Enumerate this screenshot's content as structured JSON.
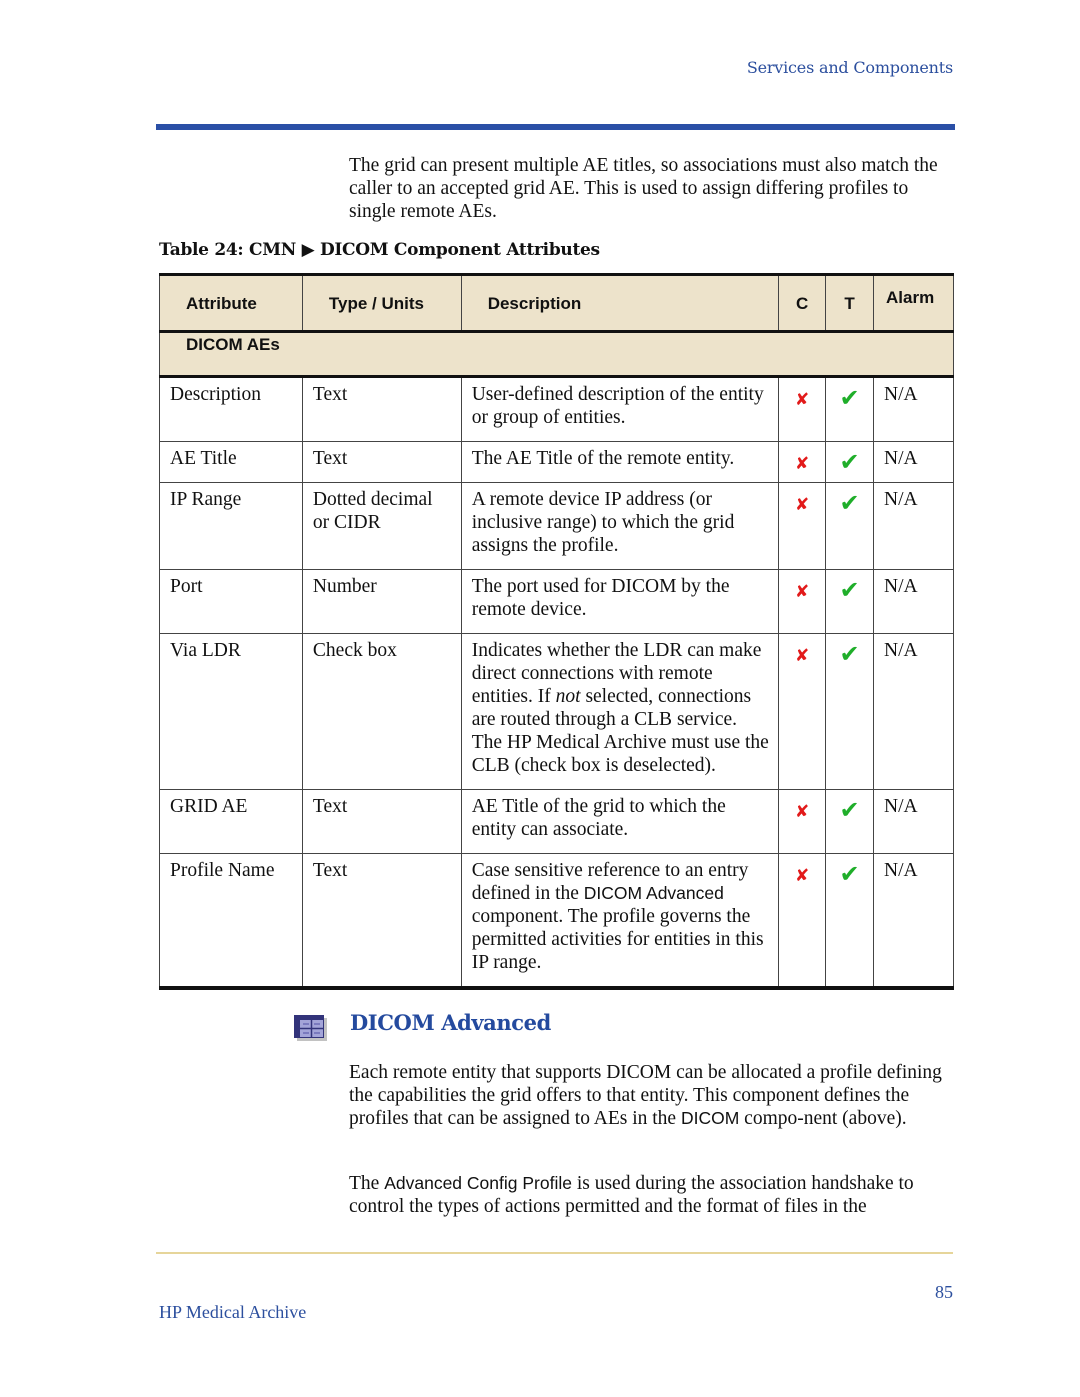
{
  "header": {
    "running_head": "Services and Components"
  },
  "intro_paragraph": "The grid can present multiple AE titles, so associations must also match the caller to an accepted grid AE. This is used to assign differing profiles to single remote AEs.",
  "table": {
    "caption": "Table 24: CMN ▶ DICOM Component Attributes",
    "columns": [
      "Attribute",
      "Type / Units",
      "Description",
      "C",
      "T",
      "Alarm"
    ],
    "group_label": "DICOM AEs",
    "rows": [
      {
        "attribute": "Description",
        "type": "Text",
        "description": "User-defined description of the entity or group of entities.",
        "c": "✘",
        "t": "✔",
        "alarm": "N/A"
      },
      {
        "attribute": "AE Title",
        "type": "Text",
        "description": "The AE Title of the remote entity.",
        "c": "✘",
        "t": "✔",
        "alarm": "N/A"
      },
      {
        "attribute": "IP Range",
        "type": "Dotted decimal or CIDR",
        "description": "A remote device IP address (or inclusive range) to which the grid assigns the profile.",
        "c": "✘",
        "t": "✔",
        "alarm": "N/A"
      },
      {
        "attribute": "Port",
        "type": "Number",
        "description": "The port used for DICOM by the remote device.",
        "c": "✘",
        "t": "✔",
        "alarm": "N/A"
      },
      {
        "attribute": "Via LDR",
        "type": "Check box",
        "description_parts": [
          "Indicates whether the LDR can make direct connections with remote entities. If ",
          "not",
          " selected, connections are routed through a CLB service. The HP Medical Archive must use the CLB (check box is deselected)."
        ],
        "c": "✘",
        "t": "✔",
        "alarm": "N/A"
      },
      {
        "attribute": "GRID AE",
        "type": "Text",
        "description": "AE Title of the grid to which the entity can associate.",
        "c": "✘",
        "t": "✔",
        "alarm": "N/A"
      },
      {
        "attribute": "Profile Name",
        "type": "Text",
        "description_parts": [
          "Case sensitive reference to an entry defined in the ",
          "DICOM Advanced",
          " component. The profile governs the permitted activities for entities in this IP range."
        ],
        "c": "✘",
        "t": "✔",
        "alarm": "N/A"
      }
    ]
  },
  "section": {
    "icon": "component-grid-icon",
    "title": "DICOM Advanced",
    "paragraph1_parts": [
      "Each remote entity that supports DICOM can be allocated a profile defining the capabilities the grid offers to that entity. This component defines the profiles that can be assigned to AEs in the ",
      "DICOM",
      " compo-nent (above)."
    ],
    "paragraph2_parts": [
      "The ",
      "Advanced Config Profile",
      " is used during the association handshake to control the types of actions permitted and the format of files in the"
    ]
  },
  "footer": {
    "page_number": "85",
    "title": "HP Medical Archive"
  },
  "colors": {
    "accent_blue": "#2a4fa6",
    "table_header_bg": "#ede3cb",
    "cross_red": "#e21a1a",
    "check_green": "#1fae2a",
    "footer_rule": "#e6d59a"
  }
}
